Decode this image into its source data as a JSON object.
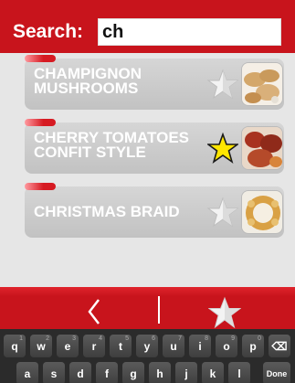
{
  "search": {
    "label": "Search:",
    "value": "ch"
  },
  "results": [
    {
      "name": "CHAMPIGNON MUSHROOMS",
      "favorite": false,
      "image": "mushrooms-photo"
    },
    {
      "name": "CHERRY TOMATOES CONFIT STYLE",
      "favorite": true,
      "image": "tomatoes-photo"
    },
    {
      "name": "CHRISTMAS BRAID",
      "favorite": false,
      "image": "braid-photo"
    }
  ],
  "navbar": {
    "back_icon": "back-chevron-icon",
    "favorites_icon": "star-icon"
  },
  "keyboard": {
    "row1": [
      {
        "key": "q",
        "alt": "1"
      },
      {
        "key": "w",
        "alt": "2"
      },
      {
        "key": "e",
        "alt": "3"
      },
      {
        "key": "r",
        "alt": "4"
      },
      {
        "key": "t",
        "alt": "5"
      },
      {
        "key": "y",
        "alt": "6"
      },
      {
        "key": "u",
        "alt": "7"
      },
      {
        "key": "i",
        "alt": "8"
      },
      {
        "key": "o",
        "alt": "9"
      },
      {
        "key": "p",
        "alt": "0"
      },
      {
        "key": "⌫",
        "alt": ""
      }
    ],
    "row2": [
      "a",
      "s",
      "d",
      "f",
      "g",
      "h",
      "j",
      "k",
      "l",
      "Done"
    ]
  },
  "colors": {
    "brand_red": "#c8141c",
    "favorite_star": "#ffe600",
    "item_bg": "#c9c9c9"
  }
}
